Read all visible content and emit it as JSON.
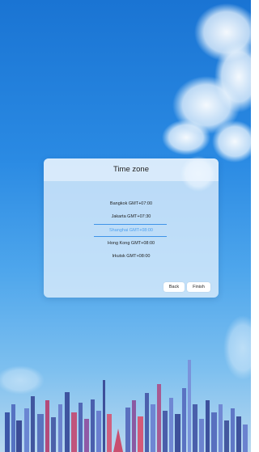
{
  "dialog": {
    "title": "Time zone",
    "items": [
      {
        "label": "Bangkok GMT+07:00",
        "selected": false
      },
      {
        "label": "Jakarta GMT+07:30",
        "selected": false
      },
      {
        "label": "Shanghai GMT+08:00",
        "selected": true
      },
      {
        "label": "Hong Kong GMT+08:00",
        "selected": false
      },
      {
        "label": "Irkutsk GMT+08:00",
        "selected": false
      }
    ],
    "back_label": "Back",
    "finish_label": "Finish"
  },
  "colors": {
    "accent": "#3f93e8",
    "selected_text": "#4ea0ef",
    "sky_top": "#1a74d3",
    "sky_bottom": "#b9d8ef"
  }
}
